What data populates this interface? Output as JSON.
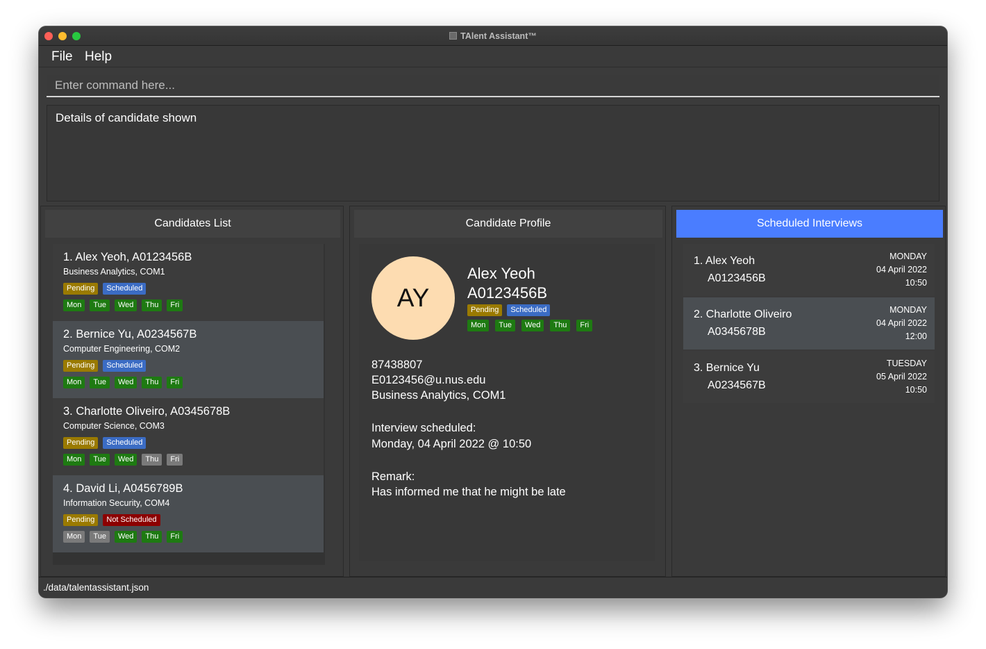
{
  "window": {
    "title": "TAlent Assistant™"
  },
  "menu": {
    "file": "File",
    "help": "Help"
  },
  "command": {
    "placeholder": "Enter command here..."
  },
  "result": {
    "text": "Details of candidate shown"
  },
  "candidates": {
    "header": "Candidates List",
    "items": [
      {
        "name": "1.  Alex Yeoh, A0123456B",
        "course": "Business Analytics, COM1",
        "status": "Pending",
        "interview": "Scheduled",
        "days": [
          "Mon",
          "Tue",
          "Wed",
          "Thu",
          "Fri"
        ]
      },
      {
        "name": "2.  Bernice Yu, A0234567B",
        "course": "Computer Engineering, COM2",
        "status": "Pending",
        "interview": "Scheduled",
        "days": [
          "Mon",
          "Tue",
          "Wed",
          "Thu",
          "Fri"
        ]
      },
      {
        "name": "3.  Charlotte Oliveiro, A0345678B",
        "course": "Computer Science, COM3",
        "status": "Pending",
        "interview": "Scheduled",
        "days": [
          "Mon",
          "Tue",
          "Wed",
          "Thu",
          "Fri"
        ]
      },
      {
        "name": "4.  David Li, A0456789B",
        "course": "Information Security, COM4",
        "status": "Pending",
        "interview": "Not Scheduled",
        "days": [
          "Mon",
          "Tue",
          "Wed",
          "Thu",
          "Fri"
        ]
      }
    ]
  },
  "profile": {
    "header": "Candidate Profile",
    "initials": "AY",
    "name": "Alex Yeoh",
    "id": "A0123456B",
    "status": "Pending",
    "interview": "Scheduled",
    "days": [
      "Mon",
      "Tue",
      "Wed",
      "Thu",
      "Fri"
    ],
    "phone": "87438807",
    "email": "E0123456@u.nus.edu",
    "course": "Business Analytics, COM1",
    "interview_label": "Interview scheduled:",
    "interview_time": "Monday, 04 April 2022  @ 10:50",
    "remark_label": "Remark:",
    "remark": "Has informed me that he might be late"
  },
  "interviews": {
    "header": "Scheduled Interviews",
    "items": [
      {
        "name": "1.  Alex Yeoh",
        "id": "A0123456B",
        "day": "MONDAY",
        "date": "04 April 2022",
        "time": "10:50"
      },
      {
        "name": "2.  Charlotte Oliveiro",
        "id": "A0345678B",
        "day": "MONDAY",
        "date": "04 April 2022",
        "time": "12:00"
      },
      {
        "name": "3.  Bernice Yu",
        "id": "A0234567B",
        "day": "TUESDAY",
        "date": "05 April 2022",
        "time": "10:50"
      }
    ]
  },
  "status_bar": {
    "path": "./data/talentassistant.json"
  }
}
